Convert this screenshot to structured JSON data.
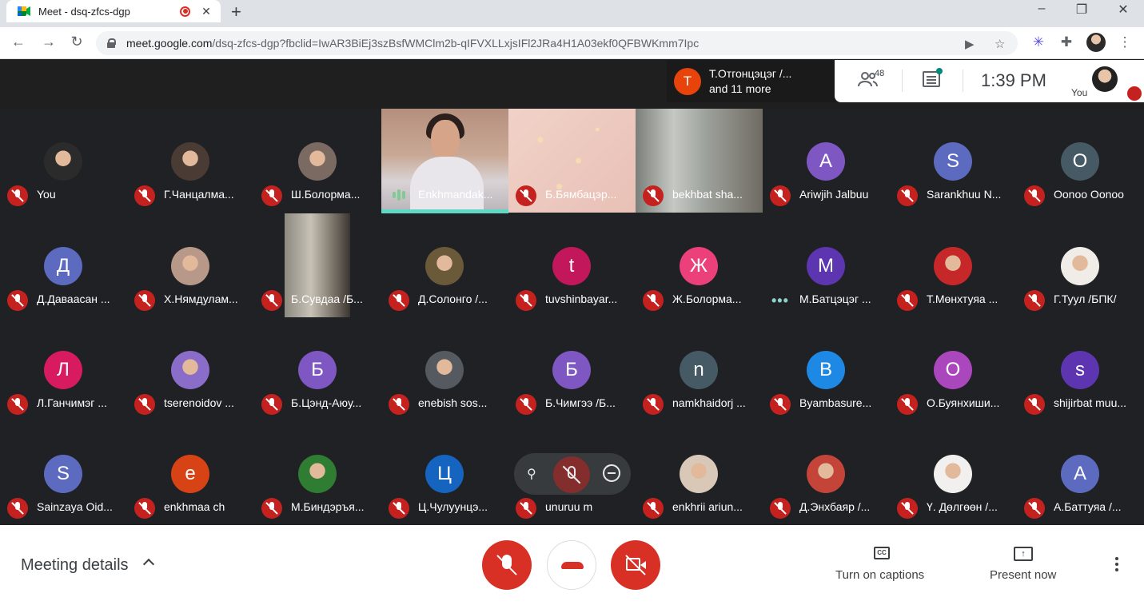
{
  "browser": {
    "tab_title": "Meet - dsq-zfcs-dgp",
    "tab_close": "✕",
    "new_tab": "+",
    "url_host": "meet.google.com",
    "url_path": "/dsq-zfcs-dgp?fbclid=IwAR3BiEj3szBsfWMClm2b-qIFVXLLxjsIFl2JRa4H1A03ekf0QFBWKmm7Ipc",
    "window_controls": [
      "–",
      "❐",
      "✕"
    ],
    "nav": {
      "back": "←",
      "forward": "→",
      "reload": "↻"
    },
    "omni_icons": {
      "camera": "▶",
      "star": "☆"
    },
    "ext_icons": {
      "snowflake": "✳",
      "puzzle": "✚",
      "menu": "⋮"
    }
  },
  "meet_top": {
    "speaker_initial": "T",
    "speaker_line1": "Т.Отгонцэцэг /...",
    "speaker_line2": "and 11 more",
    "participant_count": "48",
    "time": "1:39  PM",
    "you_label": "You"
  },
  "tiles": [
    {
      "name": "You",
      "avatar": "photo",
      "color": "#2b2b2b"
    },
    {
      "name": "Г.Чанцалма...",
      "avatar": "photo",
      "color": "#4a3b35"
    },
    {
      "name": "Ш.Болорма...",
      "avatar": "photo",
      "color": "#7a6a62"
    },
    {
      "name": "Enkhmandak...",
      "avatar": "video-enkh",
      "speaking": true
    },
    {
      "name": "Б.Бямбацэр...",
      "avatar": "video-bbya"
    },
    {
      "name": "bekhbat sha...",
      "avatar": "video-bekh"
    },
    {
      "name": "Ariwjih Jalbuu",
      "initial": "A",
      "color": "#7e57c2"
    },
    {
      "name": "Sarankhuu N...",
      "initial": "S",
      "color": "#5c6bc0"
    },
    {
      "name": "Oonoo Oonoo",
      "initial": "O",
      "color": "#455a64"
    },
    {
      "name": "Д.Даваасан ...",
      "initial": "Д",
      "color": "#5c6bc0"
    },
    {
      "name": "Х.Нямдулам...",
      "avatar": "photo",
      "color": "#b89888"
    },
    {
      "name": "Б.Сувдаа /Б...",
      "avatar": "video-svd"
    },
    {
      "name": "Д.Солонго /...",
      "avatar": "photo",
      "color": "#6b5a3a"
    },
    {
      "name": "tuvshinbayar...",
      "initial": "t",
      "color": "#c2185b"
    },
    {
      "name": "Ж.Болорма...",
      "initial": "Ж",
      "color": "#ec407a"
    },
    {
      "name": "М.Батцэцэг ...",
      "initial": "М",
      "color": "#5e35b1",
      "dots": true
    },
    {
      "name": "Т.Мөнхтуяа ...",
      "avatar": "photo",
      "color": "#c6282a"
    },
    {
      "name": "Г.Туул /БПК/",
      "avatar": "photo",
      "color": "#f0ede8"
    },
    {
      "name": "Л.Ганчимэг ...",
      "initial": "Л",
      "color": "#d81b60"
    },
    {
      "name": "tserenoidov ...",
      "avatar": "photo",
      "color": "#8a6cc9"
    },
    {
      "name": "Б.Цэнд-Аюу...",
      "initial": "Б",
      "color": "#7e57c2"
    },
    {
      "name": "enebish sos...",
      "avatar": "photo",
      "color": "#555a60"
    },
    {
      "name": "Б.Чимгээ /Б...",
      "initial": "Б",
      "color": "#7e57c2"
    },
    {
      "name": "namkhaidorj ...",
      "initial": "n",
      "color": "#455a64"
    },
    {
      "name": "Byambasure...",
      "initial": "B",
      "color": "#1e88e5"
    },
    {
      "name": "О.Буянхиши...",
      "initial": "О",
      "color": "#ab47bc"
    },
    {
      "name": "shijirbat muu...",
      "initial": "s",
      "color": "#5e35b1"
    },
    {
      "name": "Sainzaya Oid...",
      "initial": "S",
      "color": "#5c6bc0"
    },
    {
      "name": "enkhmaa ch",
      "initial": "e",
      "color": "#d84315"
    },
    {
      "name": "М.Биндэръя...",
      "avatar": "photo",
      "color": "#2e7d32"
    },
    {
      "name": "Ц.Чулуунцэ...",
      "initial": "Ц",
      "color": "#1565c0"
    },
    {
      "name": "unuruu m",
      "initial": "",
      "color": "#202124",
      "hovered": true
    },
    {
      "name": "enkhrii ariun...",
      "avatar": "photo",
      "color": "#d9c8b8"
    },
    {
      "name": "Д.Энхбаяр /...",
      "avatar": "photo",
      "color": "#c4443a"
    },
    {
      "name": "Ү. Дөлгөөн /...",
      "avatar": "photo",
      "color": "#f2f0ee"
    },
    {
      "name": "А.Баттуяа /...",
      "initial": "A",
      "color": "#5c6bc0"
    }
  ],
  "bottom": {
    "meeting_details": "Meeting details",
    "captions": "Turn on captions",
    "cc": "CC",
    "present": "Present now",
    "present_glyph": "↑"
  },
  "tile_hover": {
    "pin": "⚲"
  }
}
